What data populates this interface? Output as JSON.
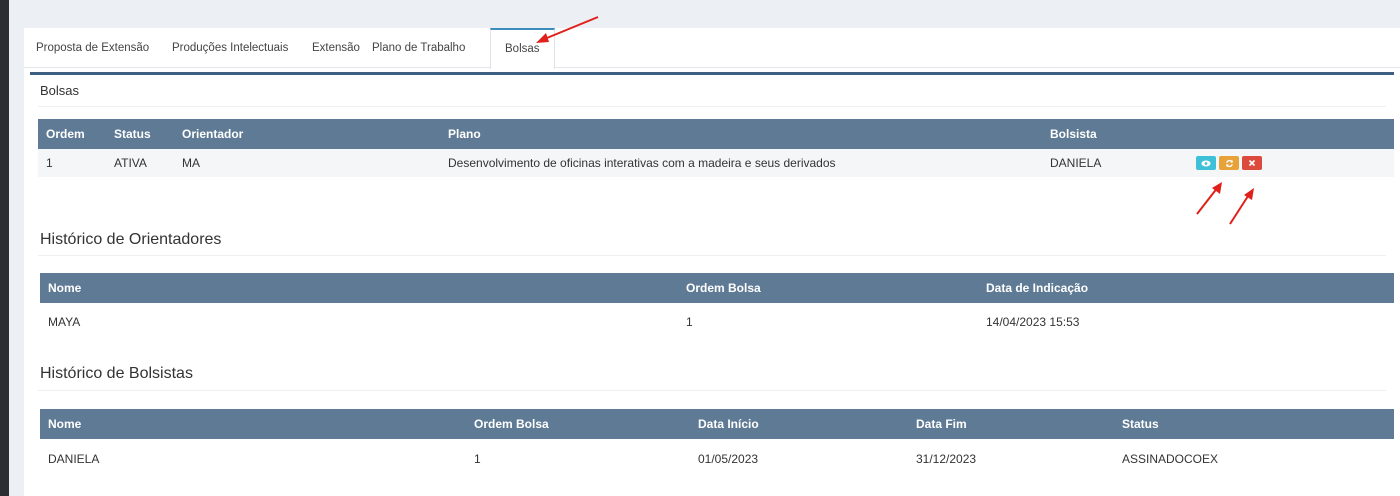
{
  "tabs": [
    {
      "label": "Proposta de Extensão",
      "active": false
    },
    {
      "label": "Produções Intelectuais",
      "active": false
    },
    {
      "label": "Extensão",
      "active": false
    },
    {
      "label": "Plano de Trabalho",
      "active": false
    },
    {
      "label": "Bolsas",
      "active": true
    }
  ],
  "box": {
    "title": "Bolsas"
  },
  "bolsas_table": {
    "headers": [
      "Ordem",
      "Status",
      "Orientador",
      "Plano",
      "Bolsista",
      ""
    ],
    "rows": [
      {
        "ordem": "1",
        "status": "ATIVA",
        "orientador": "MA",
        "plano": "Desenvolvimento de oficinas interativas com a madeira e seus derivados",
        "bolsista": "DANIELA"
      }
    ],
    "actions": [
      {
        "name": "view",
        "icon": "eye-icon"
      },
      {
        "name": "swap",
        "icon": "refresh-icon"
      },
      {
        "name": "delete",
        "icon": "close-icon"
      }
    ]
  },
  "historico_orientadores": {
    "title": "Histórico de Orientadores",
    "headers": [
      "Nome",
      "Ordem Bolsa",
      "Data de Indicação"
    ],
    "rows": [
      {
        "nome": "MAYA",
        "ordem": "1",
        "data": "14/04/2023 15:53"
      }
    ]
  },
  "historico_bolsistas": {
    "title": "Histórico de Bolsistas",
    "headers": [
      "Nome",
      "Ordem Bolsa",
      "Data Início",
      "Data Fim",
      "Status"
    ],
    "rows": [
      {
        "nome": "DANIELA",
        "ordem": "1",
        "inicio": "01/05/2023",
        "fim": "31/12/2023",
        "status": "ASSINADOCOEX"
      }
    ]
  },
  "colors": {
    "header_bg": "#5e7a94",
    "box_border": "#3f5f82",
    "arrow": "#e0201b"
  }
}
